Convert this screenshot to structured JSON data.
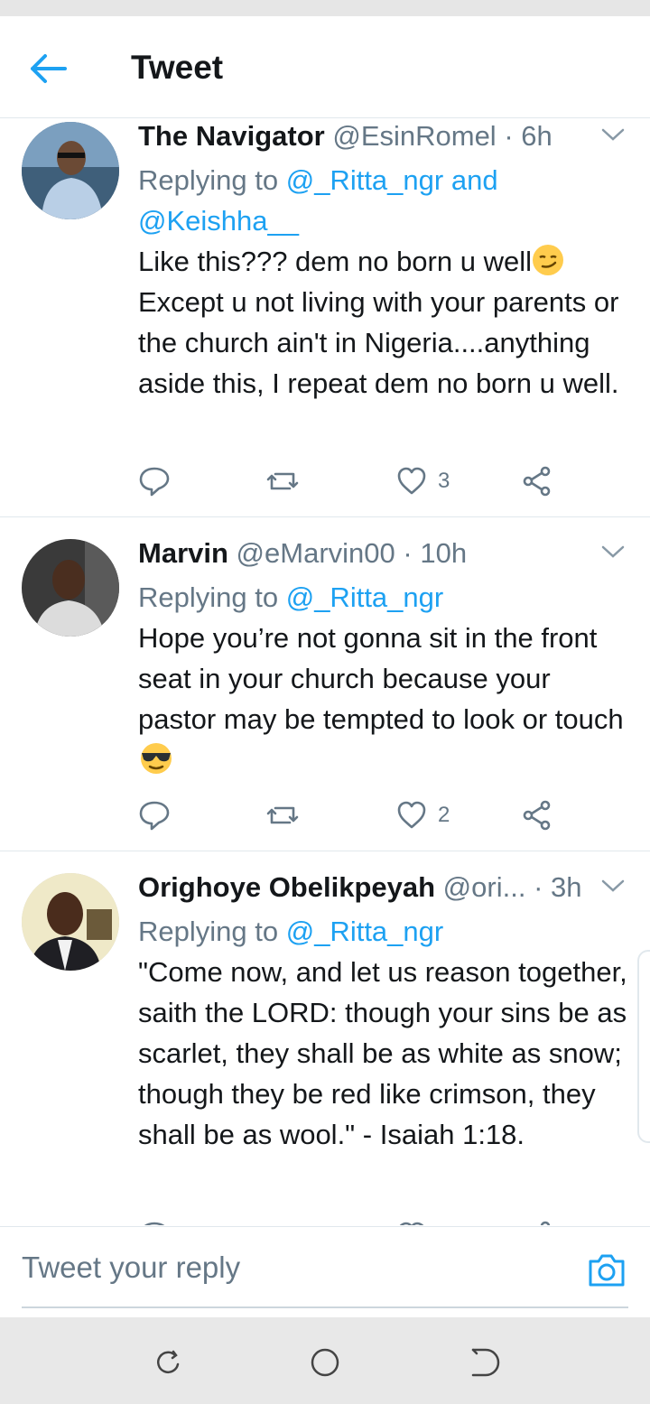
{
  "header": {
    "title": "Tweet",
    "back_icon": "arrow-left-icon",
    "accent": "#1da1f2"
  },
  "colors": {
    "accent": "#1da1f2",
    "secondary_text": "#657786",
    "primary_text": "#14171a",
    "divider": "#e1e8ed"
  },
  "tweets": [
    {
      "name": "The Navigator",
      "handle": "@EsinRomel",
      "sep": "·",
      "time": "6h",
      "reply_prefix": "Replying to",
      "mention1": "@_Ritta_ngr",
      "reply_and": "and",
      "mention2": "@Keishha__",
      "text": "Like this??? dem no born u well",
      "text_emoji": "smirk-emoji",
      "text2": "Except u not living with your parents or the church ain't in Nigeria....anything aside this, I repeat dem no born u well.",
      "likes": "3"
    },
    {
      "name": "Marvin",
      "handle": "@eMarvin00",
      "sep": "·",
      "time": "10h",
      "reply_prefix": "Replying to",
      "mention1": "@_Ritta_ngr",
      "text": "Hope you’re not gonna sit in the front seat in your church because your pastor may be tempted to look or touch",
      "text_emoji": "sunglasses-emoji",
      "likes": "2"
    },
    {
      "name": "Orighoye Obelikpeyah",
      "handle": "@ori...",
      "sep": "·",
      "time": "3h",
      "reply_prefix": "Replying to",
      "mention1": "@_Ritta_ngr",
      "text": "\"Come now, and let us reason together, saith the LORD: though your sins be as scarlet, they shall be as white as snow; though they be red like crimson, they shall be as wool.\" - Isaiah 1:18."
    }
  ],
  "reply_bar": {
    "placeholder": "Tweet your reply",
    "camera_icon": "camera-icon"
  },
  "navbar": {
    "icons": [
      "recent-apps-icon",
      "home-icon",
      "back-icon"
    ]
  }
}
